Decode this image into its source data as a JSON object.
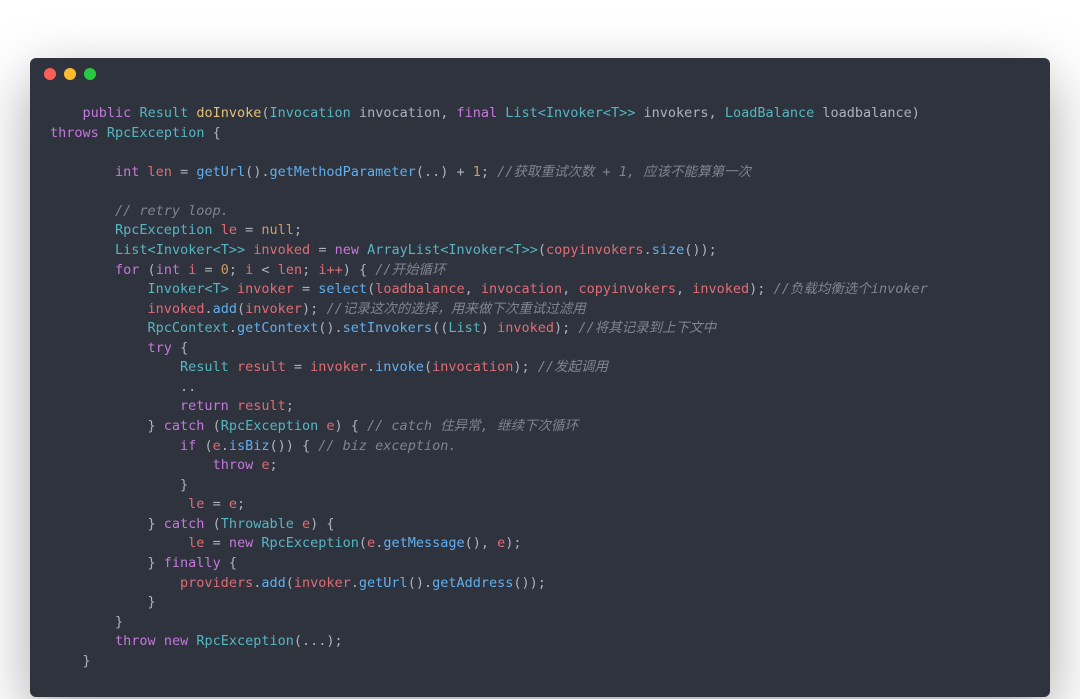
{
  "window": {
    "dots": [
      "red",
      "yellow",
      "green"
    ]
  },
  "code": {
    "sig1_prefix": "    ",
    "kw_public": "public",
    "ty_Result": "Result",
    "fn_doInvoke": "doInvoke",
    "sig_open": "(",
    "ty_Invocation": "Invocation",
    "arg_invocation": " invocation",
    "sig_comma1": ", ",
    "kw_final": "final",
    "ty_List": "List",
    "lt": "<",
    "gt": ">",
    "ty_Invoker": "Invoker",
    "ty_T": "T",
    "arg_invokers": " invokers",
    "sig_comma2": ", ",
    "ty_LoadBalance": "LoadBalance",
    "arg_loadbalance": " loadbalance",
    "sig_close": ")",
    "kw_throws": "throws",
    "ty_RpcException": "RpcException",
    "brace_open": " {",
    "len_indent": "        ",
    "kw_int": "int",
    "var_len": " len",
    "assign": " = ",
    "call_getUrl": "getUrl",
    "parens_empty": "()",
    "dot": ".",
    "call_getMethodParameter": "getMethodParameter",
    "args_dots": "(..)",
    "plus_one": " + ",
    "num_1": "1",
    "semi": ";",
    "cmt_len": " //获取重试次数 + 1, 应该不能算第一次",
    "blank": "",
    "cmt_retry": "        // retry loop.",
    "le_decl_pre": "        ",
    "var_le": " le",
    "eq_null": " = ",
    "kw_null": "null",
    "invoked_decl_pre": "        ",
    "var_invoked": " invoked",
    "kw_new": "new",
    "ty_ArrayList": "ArrayList",
    "var_copyinvokers": "copyinvokers",
    "call_size": "size",
    "for_pre": "        ",
    "kw_for": "for",
    "for_open": " (",
    "var_i": "i",
    "num_0": "0",
    "op_lt": " < ",
    "var_len_ref": "len",
    "i_inc": "i++",
    "for_close": ") {",
    "cmt_for": " //开始循环",
    "sel_pre": "            ",
    "var_invoker": " invoker",
    "call_select": "select",
    "args_select_open": "(",
    "arg_loadbalance_ref": "loadbalance",
    "arg_invocation_ref": "invocation",
    "arg_copyinvokers_ref": "copyinvokers",
    "arg_invoked_ref": "invoked",
    "args_select_close": ")",
    "cmt_select": " //负载均衡选个invoker",
    "add_pre": "            ",
    "var_invoked_ref": "invoked",
    "call_add": "add",
    "arg_invoker_ref": "invoker",
    "cmt_add": " //记录这次的选择，用来做下次重试过滤用",
    "ctx_pre": "            ",
    "ty_RpcContext": "RpcContext",
    "call_getContext": "getContext",
    "call_setInvokers": "setInvokers",
    "cast_list_open": "((",
    "cast_list_close": ") ",
    "cmt_ctx": " //将其记录到上下文中",
    "try_pre": "            ",
    "kw_try": "try",
    "res_pre": "                ",
    "var_result": " result",
    "call_invoke": "invoke",
    "cmt_invoke": " //发起调用",
    "dots_pre": "                ..",
    "ret_pre": "                ",
    "kw_return": "return",
    "var_result_ref": "result",
    "catch1_pre": "            } ",
    "kw_catch": "catch",
    "catch_open": " (",
    "var_e": " e",
    "catch_close": ") {",
    "cmt_catch1": " // catch 住异常, 继续下次循环",
    "if_pre": "                ",
    "kw_if": "if",
    "if_open": " (",
    "var_e_ref": "e",
    "call_isBiz": "isBiz",
    "if_close": ") {",
    "cmt_biz": " // biz exception.",
    "throw_pre": "                    ",
    "kw_throw": "throw",
    "brace16": "                }",
    "le_assign_pre": "                ",
    "le_eq_e": " = ",
    "catch2_pre": "            } ",
    "ty_Throwable": "Throwable",
    "le_new_pre": "                ",
    "call_getMessage": "getMessage",
    "finally_pre": "            } ",
    "kw_finally": "finally",
    "prov_pre": "                ",
    "var_providers": "providers",
    "call_getAddress": "getAddress",
    "brace12": "            }",
    "brace8": "        }",
    "throw_last_pre": "        ",
    "args_ellipsis": "(...)",
    "brace4": "    }"
  }
}
